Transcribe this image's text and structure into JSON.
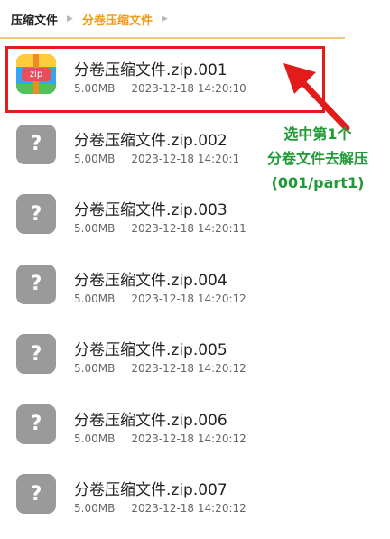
{
  "breadcrumb": {
    "items": [
      {
        "label": "压缩文件"
      },
      {
        "label": "分卷压缩文件"
      }
    ],
    "separator": "▶"
  },
  "files": [
    {
      "name": "分卷压缩文件.zip.001",
      "size": "5.00MB",
      "modified": "2023-12-18 14:20:10",
      "icon": "zip",
      "icon_text": "zip"
    },
    {
      "name": "分卷压缩文件.zip.002",
      "size": "5.00MB",
      "modified": "2023-12-18 14:20:1",
      "icon": "unknown",
      "icon_text": "?"
    },
    {
      "name": "分卷压缩文件.zip.003",
      "size": "5.00MB",
      "modified": "2023-12-18 14:20:11",
      "icon": "unknown",
      "icon_text": "?"
    },
    {
      "name": "分卷压缩文件.zip.004",
      "size": "5.00MB",
      "modified": "2023-12-18 14:20:12",
      "icon": "unknown",
      "icon_text": "?"
    },
    {
      "name": "分卷压缩文件.zip.005",
      "size": "5.00MB",
      "modified": "2023-12-18 14:20:12",
      "icon": "unknown",
      "icon_text": "?"
    },
    {
      "name": "分卷压缩文件.zip.006",
      "size": "5.00MB",
      "modified": "2023-12-18 14:20:12",
      "icon": "unknown",
      "icon_text": "?"
    },
    {
      "name": "分卷压缩文件.zip.007",
      "size": "5.00MB",
      "modified": "2023-12-18 14:20:12",
      "icon": "unknown",
      "icon_text": "?"
    }
  ],
  "annotation": {
    "lines": [
      "选中第1个",
      "分卷文件去解压",
      "(001/part1)"
    ]
  },
  "colors": {
    "accent": "#f29a1a",
    "highlight": "#e31b1b",
    "annotation": "#1e9b35",
    "unknown_icon": "#9a9a9a"
  }
}
